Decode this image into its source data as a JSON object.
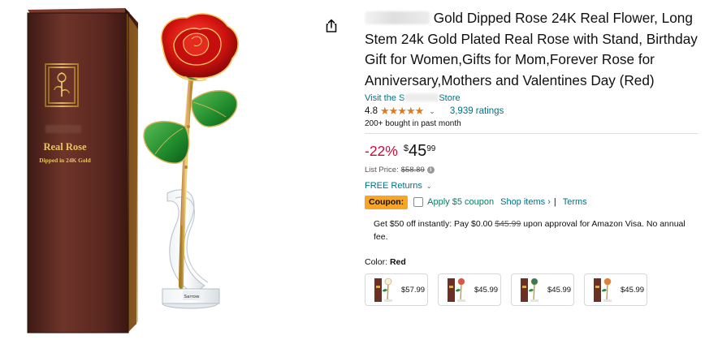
{
  "product": {
    "title_text": "Gold Dipped Rose 24K Real Flower, Long Stem 24k Gold Plated Real Rose with Stand, Birthday Gift for Women,Gifts for Mom,Forever Rose for Anniversary,Mothers and Valentines Day (Red)",
    "store_prefix": "Visit the S",
    "store_suffix": "Store",
    "rating_value": "4.8",
    "stars": "★★★★★",
    "rating_count": "3,939 ratings",
    "bought": "200+ bought in past month",
    "box_label_top": "Real Rose",
    "box_label_bottom": "Dipped in 24K Gold",
    "stand_label": "Sarrow"
  },
  "pricing": {
    "discount": "-22%",
    "currency": "$",
    "whole": "45",
    "fraction": "99",
    "list_label": "List Price:",
    "list_value": "$58.89"
  },
  "returns": {
    "label": "FREE Returns"
  },
  "coupon": {
    "badge": "Coupon:",
    "text": "Apply $5 coupon",
    "shop_items": "Shop items ›",
    "separator": "|",
    "terms": "Terms"
  },
  "visa": {
    "part1": "Get $50 off instantly: Pay $0.00 ",
    "strike": "$45.99",
    "part2": " upon approval for Amazon Visa. No annual fee."
  },
  "color": {
    "label": "Color:",
    "value": "Red"
  },
  "swatches": [
    {
      "price": "$57.99",
      "flower_color": "#f3efe2"
    },
    {
      "price": "$45.99",
      "flower_color": "#d9534f"
    },
    {
      "price": "$45.99",
      "flower_color": "#2e7d5b"
    },
    {
      "price": "$45.99",
      "flower_color": "#e0803a"
    }
  ],
  "colors": {
    "link": "#007185",
    "discount": "#cc0c39",
    "star": "#de7921",
    "coupon_badge": "#f7a427",
    "coupon_text": "#067d62"
  }
}
